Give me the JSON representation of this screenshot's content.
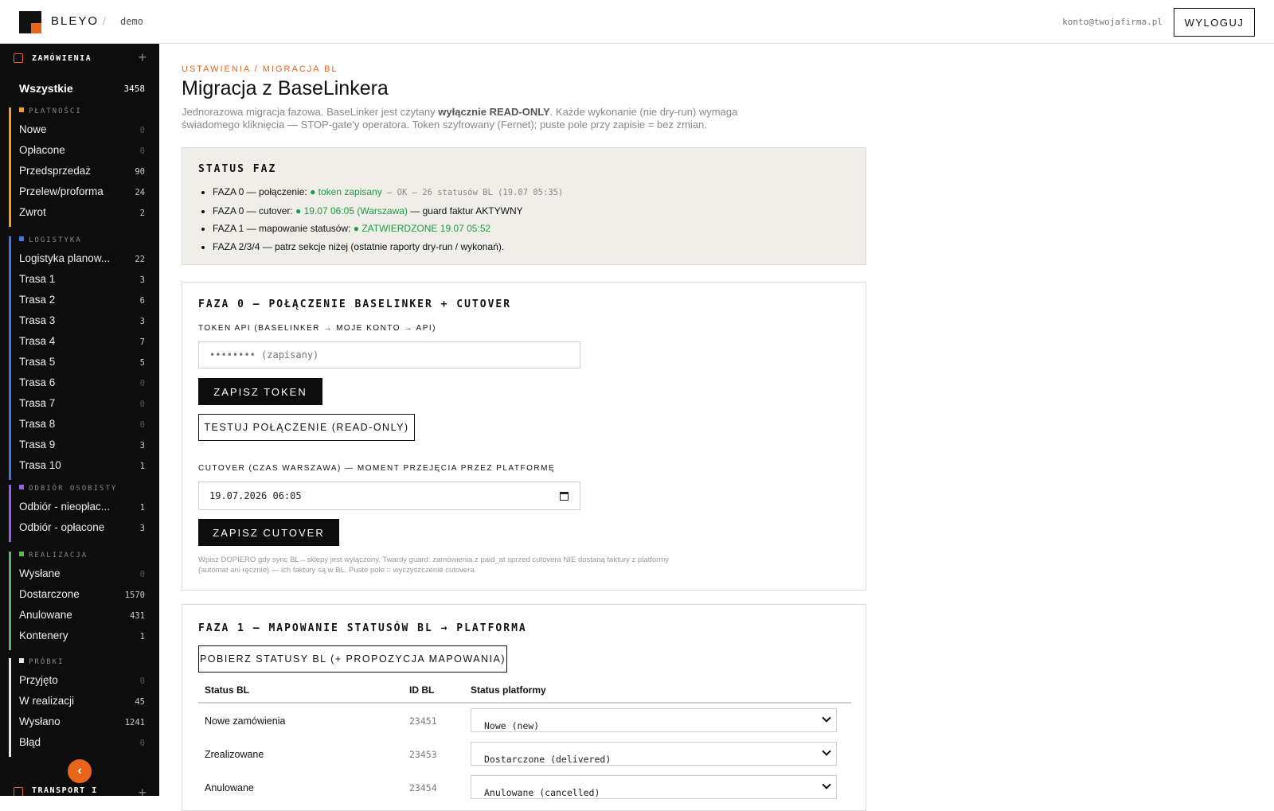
{
  "header": {
    "brand": "BLEYO",
    "separator": "/",
    "env": "demo",
    "account": "konto@twojafirma.pl",
    "logout_label": "WYLOGUJ"
  },
  "sidebar": {
    "section_title": "ZAMÓWIENIA",
    "all": {
      "label": "Wszystkie",
      "count": "3458"
    },
    "groups": [
      {
        "title": "PŁATNOŚCI",
        "color": "#f0a020",
        "items": [
          {
            "label": "Nowe",
            "count": "0"
          },
          {
            "label": "Opłacone",
            "count": "0"
          },
          {
            "label": "Przedsprzedaż",
            "count": "90"
          },
          {
            "label": "Przelew/proforma",
            "count": "24"
          },
          {
            "label": "Zwrot",
            "count": "2"
          }
        ]
      },
      {
        "title": "LOGISTYKA",
        "color": "#3b7be0",
        "items": [
          {
            "label": "Logistyka planow...",
            "count": "22"
          },
          {
            "label": "Trasa 1",
            "count": "3"
          },
          {
            "label": "Trasa 2",
            "count": "6"
          },
          {
            "label": "Trasa 3",
            "count": "3"
          },
          {
            "label": "Trasa 4",
            "count": "7"
          },
          {
            "label": "Trasa 5",
            "count": "5"
          },
          {
            "label": "Trasa 6",
            "count": "0"
          },
          {
            "label": "Trasa 7",
            "count": "0"
          },
          {
            "label": "Trasa 8",
            "count": "0"
          },
          {
            "label": "Trasa 9",
            "count": "3"
          },
          {
            "label": "Trasa 10",
            "count": "1"
          }
        ]
      },
      {
        "title": "ODBIÓR OSOBISTY",
        "color": "#9b5de5",
        "items": [
          {
            "label": "Odbiór - nieopłac...",
            "count": "1"
          },
          {
            "label": "Odbiór - opłacone",
            "count": "3"
          }
        ]
      },
      {
        "title": "REALIZACJA",
        "color": "#5cb85c",
        "items": [
          {
            "label": "Wysłane",
            "count": "0"
          },
          {
            "label": "Dostarczone",
            "count": "1570"
          },
          {
            "label": "Anulowane",
            "count": "431"
          },
          {
            "label": "Kontenery",
            "count": "1"
          }
        ]
      },
      {
        "title": "PRÓBKI",
        "color": "#e8e8e8",
        "items": [
          {
            "label": "Przyjęto",
            "count": "0"
          },
          {
            "label": "W realizacji",
            "count": "45"
          },
          {
            "label": "Wysłano",
            "count": "1241"
          },
          {
            "label": "Błąd",
            "count": "0"
          }
        ]
      }
    ],
    "bottom_section_title": "TRANSPORT I",
    "collapse_icon": "chevron-left-icon"
  },
  "page": {
    "breadcrumb": "USTAWIENIA / MIGRACJA BL",
    "title": "Migracja z BaseLinkera",
    "lead_1": "Jednorazowa migracja fazowa. BaseLinker jest czytany ",
    "lead_bold": "wyłącznie READ-ONLY",
    "lead_2": ". Każde wykonanie (nie dry-run) wymaga świadomego kliknięcia — STOP-gate'y operatora. Token szyfrowany (Fernet); puste pole przy zapisie = bez zmian."
  },
  "status": {
    "title": "STATUS FAZ",
    "rows": [
      {
        "prefix": "FAZA 0 — połączenie: ",
        "green": "● token zapisany",
        "rest": "",
        "muted": " — OK — 26 statusów BL (19.07 05:35)"
      },
      {
        "prefix": "FAZA 0 — cutover: ",
        "green": "● 19.07 06:05 (Warszawa)",
        "rest": " — guard faktur AKTYWNY",
        "muted": ""
      },
      {
        "prefix": "FAZA 1 — mapowanie statusów: ",
        "green": "● ZATWIERDZONE 19.07 05:52",
        "rest": "",
        "muted": ""
      },
      {
        "prefix": "FAZA 2/3/4 — patrz sekcje niżej (ostatnie raporty dry-run / wykonań).",
        "green": "",
        "rest": "",
        "muted": ""
      }
    ]
  },
  "phase0": {
    "title": "FAZA 0 — POŁĄCZENIE BASELINKER + CUTOVER",
    "token_label": "TOKEN API (BASELINKER → MOJE KONTO → API)",
    "token_placeholder": "•••••••• (zapisany)",
    "save_token": "ZAPISZ TOKEN",
    "test_connection": "TESTUJ POŁĄCZENIE (READ-ONLY)",
    "cutover_label": "CUTOVER (CZAS WARSZAWA) — MOMENT PRZEJĘCIA PRZEZ PLATFORMĘ",
    "cutover_value": "19.07.2026 06:05",
    "save_cutover": "ZAPISZ CUTOVER",
    "hint": "Wpisz DOPIERO gdy sync BL↔sklepy jest wyłączony. Twardy guard: zamówienia z paid_at sprzed cutovera NIE dostaną faktury z platformy (automat ani ręcznie) — ich faktury są w BL. Puste pole = wyczyszczenie cutovera."
  },
  "phase1": {
    "title": "FAZA 1 — MAPOWANIE STATUSÓW BL → PLATFORMA",
    "fetch_button": "POBIERZ STATUSY BL (+ PROPOZYCJA MAPOWANIA)",
    "columns": [
      "Status BL",
      "ID BL",
      "Status platformy"
    ],
    "rows": [
      {
        "status": "Nowe zamówienia",
        "id": "23451",
        "mapped": "Nowe (new)"
      },
      {
        "status": "Zrealizowane",
        "id": "23453",
        "mapped": "Dostarczone (delivered)"
      },
      {
        "status": "Anulowane",
        "id": "23454",
        "mapped": "Anulowane (cancelled)"
      }
    ]
  }
}
